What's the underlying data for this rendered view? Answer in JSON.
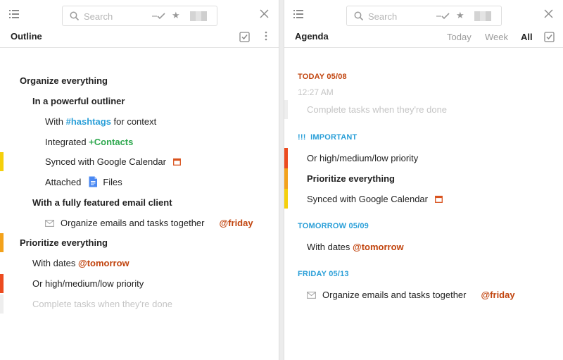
{
  "colors": {
    "tag": "#2a9fd8",
    "contact": "#2fa84f",
    "date": "#c1440e",
    "bar_yellow": "#f5d00b",
    "bar_orange": "#f3a21b",
    "bar_red": "#ec4b1f",
    "bar_gray": "#eeeeee"
  },
  "left": {
    "search_placeholder": "Search",
    "title": "Outline",
    "items": {
      "i0": "Organize everything",
      "i1": "In a powerful outliner",
      "i2_pre": "With ",
      "i2_tag": "#hashtags",
      "i2_post": " for context",
      "i3_pre": "Integrated ",
      "i3_contact": "+Contacts",
      "i4": "Synced with Google Calendar",
      "i5_pre": "Attached",
      "i5_post": "Files",
      "i6": "With a fully featured email client",
      "i7": "Organize emails and tasks together",
      "i7_date": "@friday",
      "i8": "Prioritize everything",
      "i9_pre": "With dates ",
      "i9_date": "@tomorrow",
      "i10": "Or high/medium/low priority",
      "i11": "Complete tasks when they're done"
    }
  },
  "right": {
    "search_placeholder": "Search",
    "title": "Agenda",
    "filters": {
      "today": "Today",
      "week": "Week",
      "all": "All"
    },
    "today_header": "TODAY 05/08",
    "time": "12:27 AM",
    "completed": "Complete tasks when they're done",
    "important_header": "IMPORTANT",
    "important_icon": "!!!",
    "imp1": "Or high/medium/low priority",
    "imp2": "Prioritize everything",
    "imp3": "Synced with Google Calendar",
    "tomorrow_header": "TOMORROW 05/09",
    "tom1_pre": "With dates ",
    "tom1_date": "@tomorrow",
    "friday_header": "FRIDAY 05/13",
    "fri1": "Organize emails and tasks together",
    "fri1_date": "@friday"
  }
}
